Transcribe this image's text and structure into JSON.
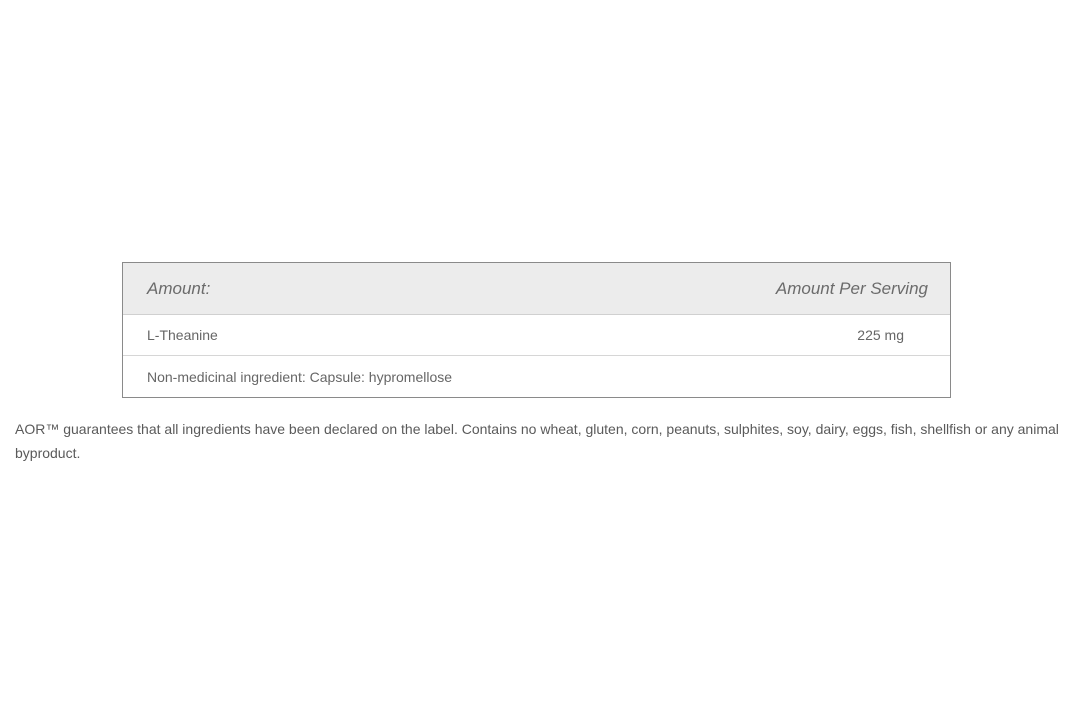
{
  "table": {
    "header": {
      "ingredient_label": "Amount:",
      "amount_label": "Amount Per Serving"
    },
    "rows": [
      {
        "ingredient": "L-Theanine",
        "amount": "225 mg"
      },
      {
        "ingredient": "Non-medicinal ingredient: Capsule: hypromellose",
        "amount": ""
      }
    ]
  },
  "disclaimer": "AOR™ guarantees that all ingredients have been declared on the label. Contains no wheat, gluten, corn, peanuts, sulphites, soy, dairy, eggs, fish, shellfish or any animal byproduct."
}
